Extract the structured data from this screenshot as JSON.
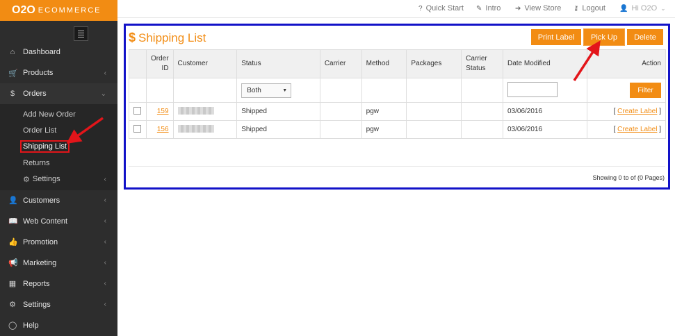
{
  "brand": {
    "logo": "O2O",
    "text": "ECOMMERCE"
  },
  "topbar": {
    "quick_start": "Quick Start",
    "intro": "Intro",
    "view_store": "View Store",
    "logout": "Logout",
    "user": "Hi O2O"
  },
  "sidebar": {
    "dashboard": "Dashboard",
    "products": "Products",
    "orders": "Orders",
    "orders_sub": {
      "add_new": "Add New Order",
      "order_list": "Order List",
      "shipping_list": "Shipping List",
      "returns": "Returns",
      "settings": "Settings"
    },
    "customers": "Customers",
    "web_content": "Web Content",
    "promotion": "Promotion",
    "marketing": "Marketing",
    "reports": "Reports",
    "settings": "Settings",
    "help": "Help"
  },
  "panel": {
    "title": "Shipping List",
    "print_label": "Print Label",
    "pick_up": "Pick Up",
    "delete": "Delete"
  },
  "table": {
    "headers": {
      "order_id_1": "Order",
      "order_id_2": "ID",
      "customer": "Customer",
      "status": "Status",
      "carrier": "Carrier",
      "method": "Method",
      "packages": "Packages",
      "carrier_status_1": "Carrier",
      "carrier_status_2": "Status",
      "date_modified": "Date Modified",
      "action": "Action"
    },
    "filter": {
      "status_selected": "Both",
      "filter_button": "Filter"
    },
    "rows": [
      {
        "order_id": "159",
        "status": "Shipped",
        "carrier": "",
        "method": "pgw",
        "packages": "",
        "carrier_status": "",
        "date": "03/06/2016",
        "action": "Create Label"
      },
      {
        "order_id": "156",
        "status": "Shipped",
        "carrier": "",
        "method": "pgw",
        "packages": "",
        "carrier_status": "",
        "date": "03/06/2016",
        "action": "Create Label"
      }
    ],
    "showing": "Showing 0 to of (0 Pages)"
  },
  "colors": {
    "accent": "#f28c13",
    "sidebar": "#2d2d2d",
    "highlight_box": "#1212c8",
    "annotation": "#e3151a"
  }
}
